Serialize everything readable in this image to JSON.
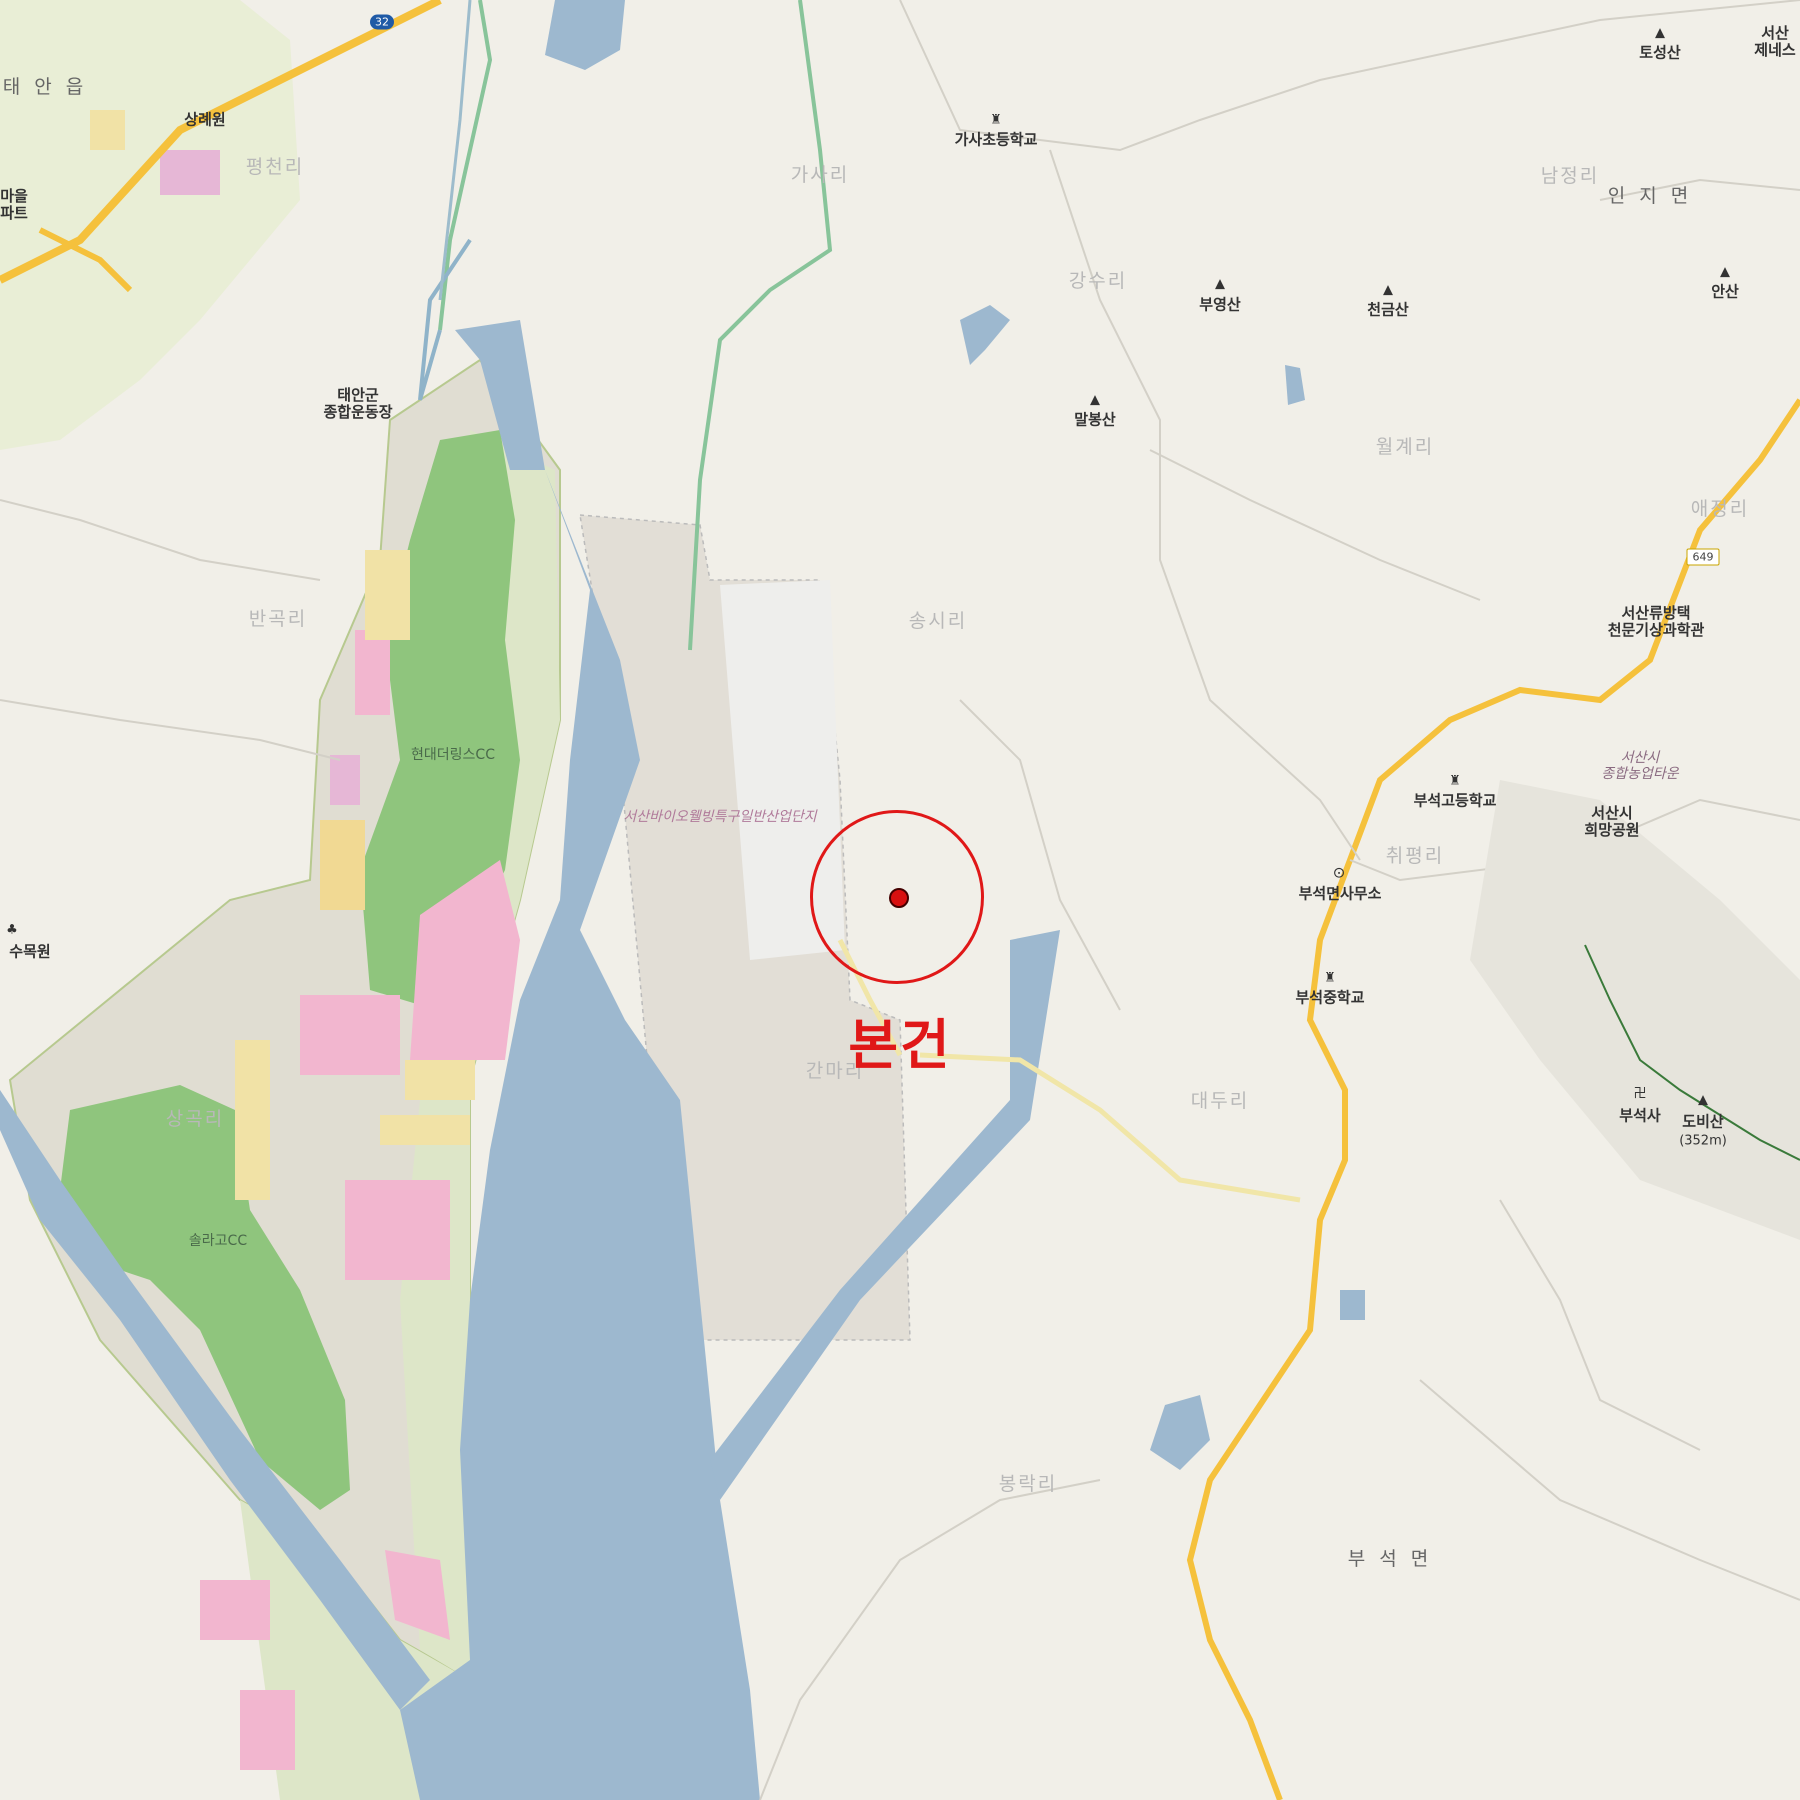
{
  "map": {
    "subject_label": "본건",
    "towns": {
      "taean": "태 안 읍",
      "inji": "인 지 면",
      "buseok": "부 석 면"
    },
    "villages": {
      "pyeongcheon": "평천리",
      "gasa": "가사리",
      "gangsu": "강수리",
      "namjeong": "남정리",
      "wolgye": "월계리",
      "aejeong": "애정리",
      "bangok": "반곡리",
      "songsi": "송시리",
      "chwipyeong": "취평리",
      "gama": "간마리",
      "daedu": "대두리",
      "bongnak": "봉락리",
      "sangok": "상곡리"
    },
    "mountains": {
      "tosung": "토성산",
      "buyeong": "부영산",
      "cheongeum": "천금산",
      "ansan": "안산",
      "malbong": "말봉산",
      "dobi": "도비산",
      "dobi_alt": "(352m)"
    },
    "pois": {
      "sangnewon": "상례원",
      "apartment": "마을\n파트",
      "sports": "태안군\n종합운동장",
      "gasa_school": "가사초등학교",
      "hyundai_cc": "현대더링스CC",
      "solago_cc": "솔라고CC",
      "arboretum": "수목원",
      "buseok_high": "부석고등학교",
      "buseok_office": "부석면사무소",
      "buseok_middle": "부석중학교",
      "observatory": "서산류방택\n천문기상과학관",
      "hope_park": "서산시\n희망공원",
      "buseoksa": "부석사",
      "top_right": "서산\n제네스",
      "industrial": "서산바이오웰빙특구일반산업단지",
      "agri_town": "서산시\n종합농업타운"
    },
    "route_shields": {
      "r32": "32",
      "r649": "649"
    },
    "colors": {
      "land": "#f1efe8",
      "water": "#9db8cf",
      "golf": "#8fc57d",
      "industrial": "#f2b6cf",
      "subject_marker": "#e01818",
      "highway": "#f5c13c"
    }
  }
}
